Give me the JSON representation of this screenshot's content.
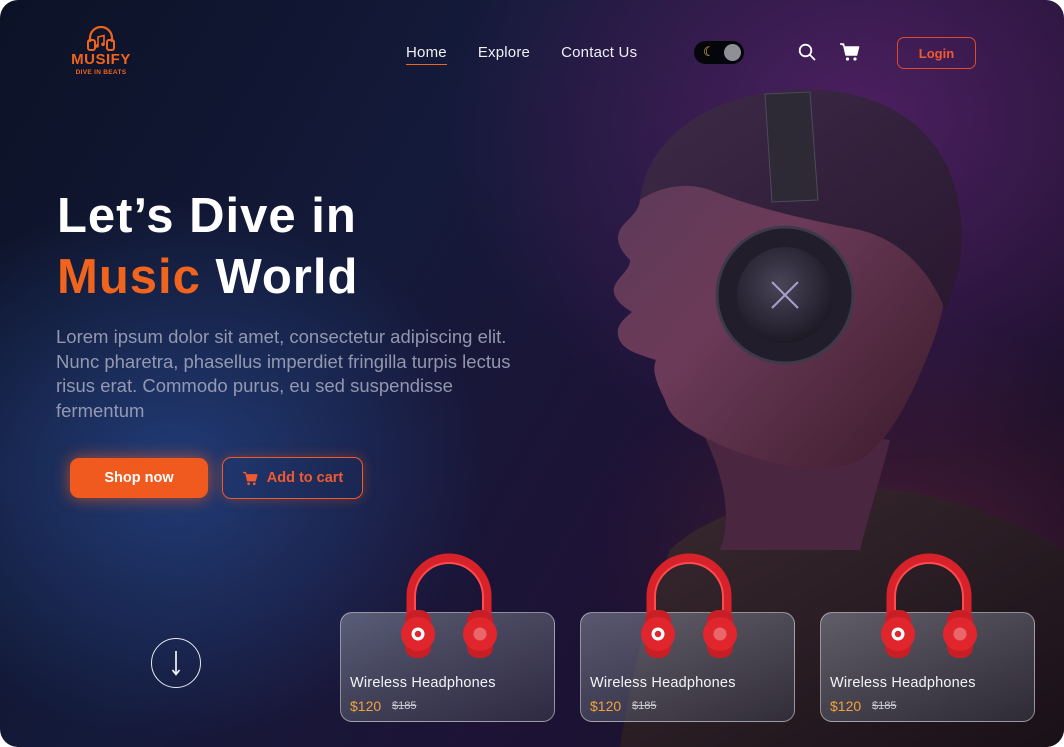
{
  "brand": {
    "name": "MUSIFY",
    "tagline": "DIVE IN BEATS"
  },
  "nav": {
    "links": [
      {
        "label": "Home",
        "active": true
      },
      {
        "label": "Explore",
        "active": false
      },
      {
        "label": "Contact Us",
        "active": false
      }
    ],
    "login_label": "Login"
  },
  "theme_toggle": {
    "mode": "dark",
    "icon": "moon-icon"
  },
  "hero": {
    "title_line1": "Let’s Dive in",
    "title_accent": "Music",
    "title_rest": " World",
    "description": "Lorem ipsum dolor sit amet, consectetur adipiscing elit. Nunc pharetra, phasellus imperdiet fringilla turpis lectus risus erat. Commodo purus, eu sed suspendisse fermentum",
    "shop_label": "Shop now",
    "cart_label": "Add to cart"
  },
  "products": [
    {
      "name": "Wireless Headphones",
      "price": "$120",
      "old_price": "$185"
    },
    {
      "name": "Wireless Headphones",
      "price": "$120",
      "old_price": "$185"
    },
    {
      "name": "Wireless Headphones",
      "price": "$120",
      "old_price": "$185"
    }
  ],
  "colors": {
    "accent": "#f0641e",
    "price": "#f2a23a",
    "background": "#141a3a",
    "headphone_red": "#e0262c"
  }
}
